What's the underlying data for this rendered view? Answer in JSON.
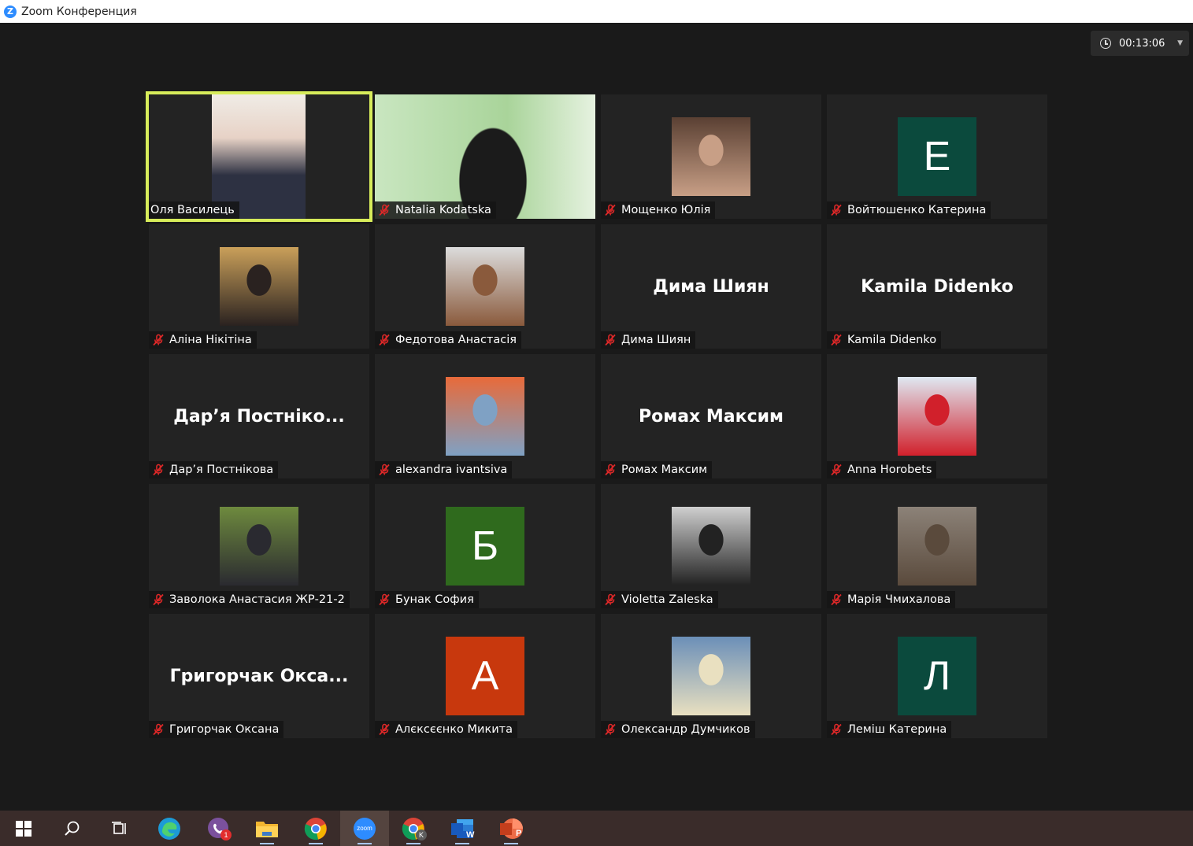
{
  "window": {
    "title": "Zoom Конференция",
    "logo_letter": "Z"
  },
  "timer": {
    "value": "00:13:06"
  },
  "participants": [
    {
      "name": "Оля Василець",
      "kind": "video",
      "active": true,
      "muted": false,
      "colors": [
        "#2d3142",
        "#e7d2c6"
      ]
    },
    {
      "name": "Natalia Kodatska",
      "kind": "video-full",
      "muted": true,
      "colors": [
        "#a9d49a",
        "#1b1b1b"
      ]
    },
    {
      "name": "Мощенко Юлія",
      "kind": "photo",
      "muted": true,
      "colors": [
        "#5a4033",
        "#c89f86"
      ]
    },
    {
      "name": "Войтюшенко Катерина",
      "kind": "letter",
      "letter": "Е",
      "bg": "#0b4a3d",
      "muted": true
    },
    {
      "name": "Аліна Нікітіна",
      "kind": "photo",
      "muted": true,
      "colors": [
        "#caa05a",
        "#2a2220"
      ]
    },
    {
      "name": "Федотова Анастасія",
      "kind": "photo",
      "muted": true,
      "colors": [
        "#dcdcdc",
        "#8a5a3c"
      ]
    },
    {
      "name": "Дима Шиян",
      "kind": "name",
      "display": "Дима Шиян",
      "muted": true
    },
    {
      "name": "Kamila Didenko",
      "kind": "name",
      "display": "Kamila Didenko",
      "muted": true
    },
    {
      "name": "Дар’я Постнікова",
      "kind": "name",
      "display": "Дар’я Постніко...",
      "muted": true
    },
    {
      "name": "alexandra ivantsiva",
      "kind": "photo",
      "muted": true,
      "colors": [
        "#e86a3a",
        "#7fa1c4"
      ]
    },
    {
      "name": "Ромах Максим",
      "kind": "name",
      "display": "Ромах Максим",
      "muted": true
    },
    {
      "name": "Anna Horobets",
      "kind": "photo",
      "muted": true,
      "colors": [
        "#dfe8f2",
        "#d1202b"
      ]
    },
    {
      "name": "Заволока Анастасия ЖР-21-2",
      "kind": "photo",
      "muted": true,
      "colors": [
        "#6e8a3e",
        "#2a2a30"
      ]
    },
    {
      "name": "Бунак София",
      "kind": "letter",
      "letter": "Б",
      "bg": "#2f6a1d",
      "muted": true
    },
    {
      "name": "Violetta Zaleska",
      "kind": "photo",
      "muted": true,
      "colors": [
        "#cfcfcf",
        "#222222"
      ]
    },
    {
      "name": "Марія Чмихалова",
      "kind": "photo",
      "muted": true,
      "colors": [
        "#8c8278",
        "#5a4a3c"
      ]
    },
    {
      "name": "Григорчак Оксана",
      "kind": "name",
      "display": "Григорчак  Окса...",
      "muted": true
    },
    {
      "name": "Алєксєєнко Микита",
      "kind": "letter",
      "letter": "А",
      "bg": "#c8380d",
      "muted": true
    },
    {
      "name": "Олександр Думчиков",
      "kind": "photo",
      "muted": true,
      "colors": [
        "#6b8fb8",
        "#e9e0c0"
      ]
    },
    {
      "name": "Леміш Катерина",
      "kind": "letter",
      "letter": "Л",
      "bg": "#0b4a3d",
      "muted": true
    }
  ],
  "taskbar": {
    "items": [
      {
        "name": "start",
        "icon": "windows-icon"
      },
      {
        "name": "search",
        "icon": "search-icon"
      },
      {
        "name": "task-view",
        "icon": "task-view-icon"
      },
      {
        "name": "edge",
        "icon": "edge-icon"
      },
      {
        "name": "viber",
        "icon": "viber-icon",
        "badge": "1"
      },
      {
        "name": "explorer",
        "icon": "folder-icon"
      },
      {
        "name": "chrome",
        "icon": "chrome-icon"
      },
      {
        "name": "zoom",
        "icon": "zoom-icon",
        "label": "zoom",
        "active": true
      },
      {
        "name": "chrome-profile",
        "icon": "chrome-icon",
        "badge": "K"
      },
      {
        "name": "word",
        "icon": "word-icon",
        "label": "W"
      },
      {
        "name": "powerpoint",
        "icon": "powerpoint-icon",
        "label": "P"
      }
    ]
  }
}
